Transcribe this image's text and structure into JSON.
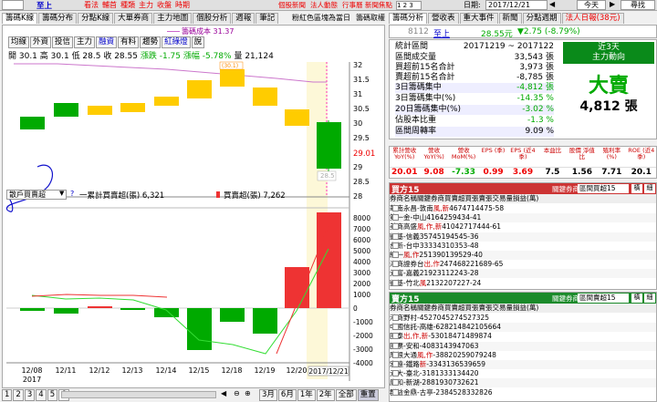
{
  "toolbar": {
    "stock_select": "至上",
    "links": [
      "看法",
      "輔首",
      "種類",
      "主力",
      "收盤",
      "時期"
    ],
    "right_links": [
      "個股新聞",
      "法人動態",
      "行事曆",
      "新聞焦點"
    ],
    "date_label": "日期:",
    "date_value": "2017/12/21",
    "today": "今天",
    "find": "尋找",
    "left_select": "1 2 3"
  },
  "left_tabs": [
    "籌碼K線",
    "籌碼分布",
    "分點K線",
    "大單券商",
    "主力地圖",
    "個股分析",
    "週報",
    "筆記"
  ],
  "left_note": "粉紅色區塊為當日",
  "left_note2": "籌碼取權",
  "legend_line": "籌碼成本 31.37",
  "kbuttons": [
    "均線",
    "外資",
    "投信",
    "主力",
    "融資",
    "有料",
    "趨勢",
    "紅綠燈",
    "說"
  ],
  "ohlc": {
    "open": "開 30.1",
    "high": "高 30.1",
    "low": "低 28.5",
    "close": "收 28.55",
    "chg": "漲跌 -1.75",
    "pct": "漲幅 -5.78%",
    "vol": "量 21,124"
  },
  "price_box": "(30.1)",
  "low_box": "28.5",
  "price_right": "29.01",
  "price_ticks": [
    "32",
    "31.5",
    "31",
    "30.5",
    "30",
    "29.5",
    "29",
    "28.5",
    "28"
  ],
  "lower": {
    "select": "散戶買賣超",
    "legend1": "一累計買賣超(張) 6,321",
    "legend2": "買賣超(張) 7,262",
    "ticks": [
      "8000",
      "7000",
      "6000",
      "5000",
      "4000",
      "3000",
      "2000",
      "1000",
      "0",
      "-1000",
      "-2000",
      "-3000",
      "-4000"
    ]
  },
  "dates": [
    "12/08",
    "12/11",
    "12/12",
    "12/13",
    "12/14",
    "12/15",
    "12/18",
    "12/19",
    "12/20",
    "2017/12/21"
  ],
  "year": "2017",
  "bottom_pages": [
    "1",
    "2",
    "3",
    "4",
    "5",
    "6"
  ],
  "bottom_buttons": [
    "3月",
    "6月",
    "1年",
    "2年",
    "全部",
    "重置"
  ],
  "right_tabs": [
    "籌碼分析",
    "營收表",
    "重大事件",
    "新聞",
    "分點週期",
    "法人日報(38元)"
  ],
  "stock": {
    "code": "8112",
    "name": "至上",
    "price": "28.55元",
    "change": "▼2.75 (-8.79%)"
  },
  "stats": [
    {
      "label": "統計區間",
      "value": "20171219 ~ 2017122"
    },
    {
      "label": "區間成交量",
      "value": "33,543 張"
    },
    {
      "label": "買超前15名合計",
      "value": "3,973 張"
    },
    {
      "label": "賣超前15名合計",
      "value": "-8,785 張"
    },
    {
      "label": "3日籌碼集中",
      "value": "-4,812 張"
    },
    {
      "label": "3日籌碼集中(%)",
      "value": "-14.35 %"
    },
    {
      "label": "20日籌碼集中(%)",
      "value": "-3.02 %"
    },
    {
      "label": "佔股本比重",
      "value": "-1.3 %"
    },
    {
      "label": "區間周轉率",
      "value": "9.09 %"
    }
  ],
  "summary": {
    "days": "近3天",
    "title": "主力動向",
    "verdict": "大賣",
    "amount": "4,812 張"
  },
  "metrics": {
    "headers": [
      "累計營收 YoY(%)",
      "營收 YoY(%)",
      "營收 MoM(%)",
      "EPS (季)",
      "EPS (近4季)",
      "本益比",
      "股價 淨值比",
      "殖利率 (%)",
      "ROE (近4季)"
    ],
    "values": [
      "20.01",
      "9.08",
      "-7.33",
      "0.99",
      "3.69",
      "7.5",
      "1.56",
      "7.71",
      "20.1"
    ],
    "colors": [
      "#e00",
      "#e00",
      "#0a0",
      "#e00",
      "#e00",
      "#000",
      "#000",
      "#000",
      "#000"
    ]
  },
  "buy15": {
    "title": "買方15",
    "filter_label": "關鍵券商:",
    "filter_value": "區間買超15",
    "btn1": "橫",
    "btn2": "細",
    "headers": [
      "券商名稱",
      "關鍵券商",
      "買賣超",
      "買張",
      "賣張",
      "交易量",
      "損益(萬)"
    ],
    "rows": [
      [
        "華南永昌-敦南",
        "風,新",
        "467",
        "471",
        "4",
        "475",
        "-58"
      ],
      [
        "第一金-中山",
        "",
        "416",
        "425",
        "9",
        "434",
        "-41"
      ],
      [
        "美商高盛",
        "風,作,新",
        "410",
        "427",
        "17",
        "444",
        "-61"
      ],
      [
        "凱基-信義",
        "",
        "357",
        "451",
        "94",
        "545",
        "-36"
      ],
      [
        "台新-台中",
        "",
        "333",
        "343",
        "10",
        "353",
        "-48"
      ],
      [
        "統一",
        "風,作",
        "251",
        "390",
        "139",
        "529",
        "-40"
      ],
      [
        "海商證券台",
        "出,作",
        "247",
        "468",
        "221",
        "689",
        "-65"
      ],
      [
        "元富-嘉義",
        "",
        "219",
        "231",
        "12",
        "243",
        "-28"
      ],
      [
        "凱基-竹北",
        "風",
        "213",
        "220",
        "7",
        "227",
        "-24"
      ]
    ]
  },
  "sell15": {
    "title": "賣方15",
    "filter_label": "關鍵券商:",
    "filter_value": "區間賣超15",
    "btn1": "橫",
    "btn2": "細",
    "headers": [
      "券商名稱",
      "關鍵券商",
      "買賣超",
      "買張",
      "賣張",
      "交易量",
      "損益(萬)"
    ],
    "rows": [
      [
        "港商野村",
        "",
        "-4527",
        "0",
        "4527",
        "4527",
        "325"
      ],
      [
        "中國信託-高雄",
        "",
        "-628",
        "214",
        "842",
        "1056",
        "64"
      ],
      [
        "國泰",
        "出,作,新",
        "-530",
        "184",
        "714",
        "898",
        "74"
      ],
      [
        "國票-安和",
        "",
        "-408",
        "31",
        "439",
        "470",
        "63"
      ],
      [
        "摩根大通",
        "風,作",
        "-388",
        "202",
        "590",
        "792",
        "48"
      ],
      [
        "宏遠-鐵路",
        "新",
        "-334",
        "31",
        "365",
        "396",
        "59"
      ],
      [
        "元大-臺北",
        "",
        "-318",
        "13",
        "331",
        "344",
        "20"
      ],
      [
        "康和-新湖",
        "",
        "-288",
        "19",
        "307",
        "326",
        "21"
      ],
      [
        "群益金鼎-古亭",
        "",
        "-238",
        "45",
        "283",
        "328",
        "26"
      ]
    ]
  }
}
